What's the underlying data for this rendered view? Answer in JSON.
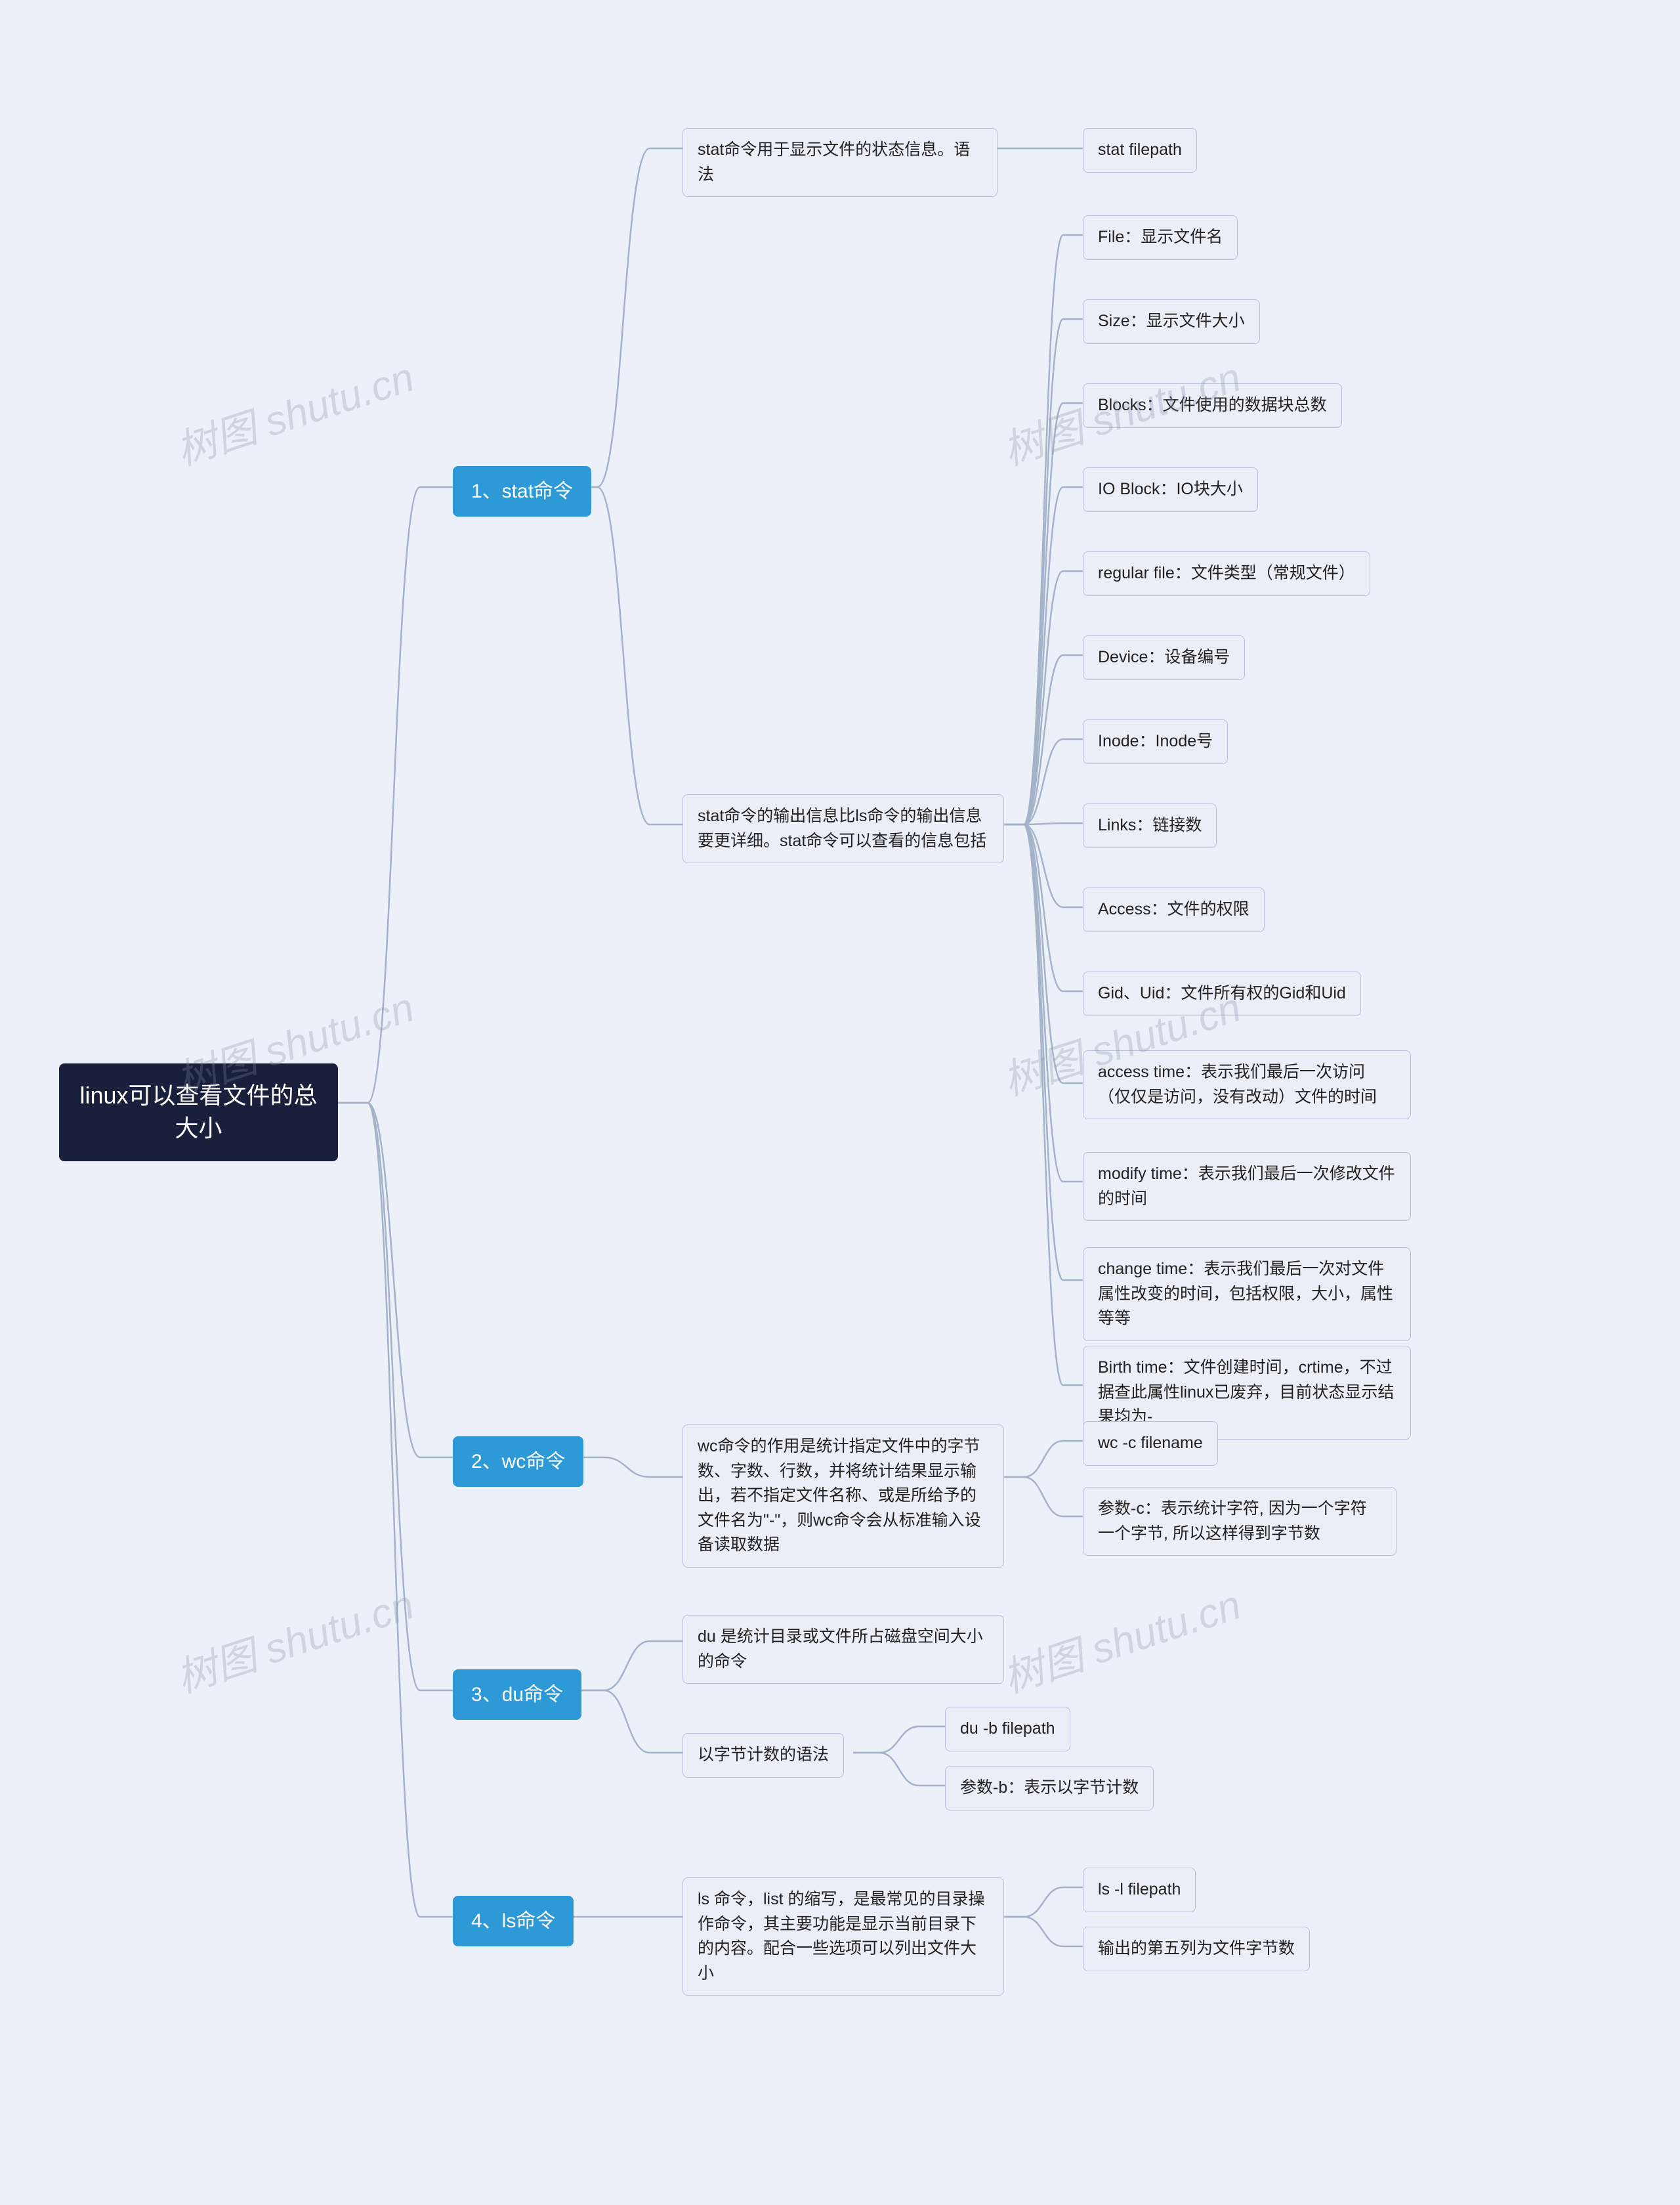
{
  "watermark": "树图 shutu.cn",
  "root": "linux可以查看文件的总大小",
  "branches": {
    "b1": "1、stat命令",
    "b2": "2、wc命令",
    "b3": "3、du命令",
    "b4": "4、ls命令"
  },
  "stat": {
    "syntax_desc": "stat命令用于显示文件的状态信息。语法",
    "syntax_cmd": "stat filepath",
    "detail_desc": "stat命令的输出信息比ls命令的输出信息要更详细。stat命令可以查看的信息包括",
    "fields": {
      "f1": "File：显示文件名",
      "f2": "Size：显示文件大小",
      "f3": "Blocks：文件使用的数据块总数",
      "f4": "IO Block：IO块大小",
      "f5": "regular file：文件类型（常规文件）",
      "f6": "Device：设备编号",
      "f7": "Inode：Inode号",
      "f8": "Links：链接数",
      "f9": "Access：文件的权限",
      "f10": "Gid、Uid：文件所有权的Gid和Uid",
      "f11": "access time：表示我们最后一次访问（仅仅是访问，没有改动）文件的时间",
      "f12": "modify time：表示我们最后一次修改文件的时间",
      "f13": "change time：表示我们最后一次对文件属性改变的时间，包括权限，大小，属性等等",
      "f14": "Birth time：文件创建时间，crtime，不过据查此属性linux已废弃，目前状态显示结果均为-"
    }
  },
  "wc": {
    "desc": "wc命令的作用是统计指定文件中的字节数、字数、行数，并将统计结果显示输出，若不指定文件名称、或是所给予的文件名为\"-\"，则wc命令会从标准输入设备读取数据",
    "cmd": "wc -c filename",
    "param": "参数-c：表示统计字符, 因为一个字符一个字节, 所以这样得到字节数"
  },
  "du": {
    "desc": "du 是统计目录或文件所占磁盘空间大小的命令",
    "syntax_label": "以字节计数的语法",
    "cmd": "du -b filepath",
    "param": "参数-b：表示以字节计数"
  },
  "ls": {
    "desc": "ls 命令，list 的缩写，是最常见的目录操作命令，其主要功能是显示当前目录下的内容。配合一些选项可以列出文件大小",
    "cmd": "ls -l filepath",
    "note": "输出的第五列为文件字节数"
  }
}
